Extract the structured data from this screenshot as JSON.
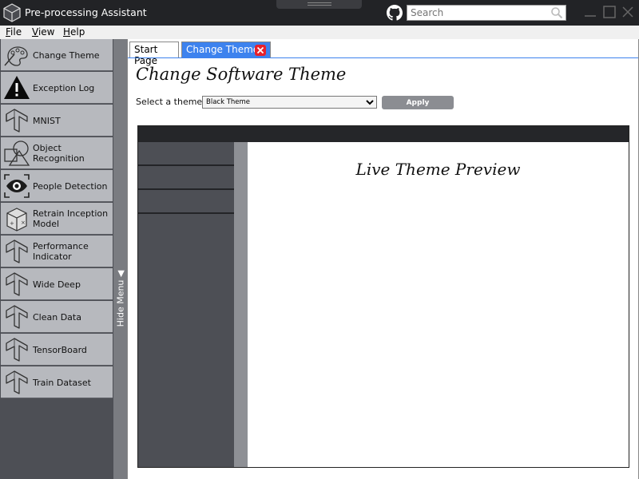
{
  "titlebar": {
    "title": "Pre-processing Assistant",
    "search_placeholder": "Search",
    "icons": [
      "cube-logo-icon",
      "github-icon",
      "search-icon",
      "minimize-icon",
      "maximize-icon",
      "close-icon"
    ]
  },
  "menu": {
    "items": [
      {
        "first": "F",
        "rest": "ile"
      },
      {
        "first": "V",
        "rest": "iew"
      },
      {
        "first": "H",
        "rest": "elp"
      }
    ]
  },
  "sidebar": {
    "items": [
      {
        "label": "Change Theme",
        "icon": "palette-icon"
      },
      {
        "label": "Exception Log",
        "icon": "warning-icon"
      },
      {
        "label": "MNIST",
        "icon": "tensorflow-icon"
      },
      {
        "label": "Object Recognition",
        "icon": "shapes-icon"
      },
      {
        "label": "People Detection",
        "icon": "eye-icon"
      },
      {
        "label": "Retrain Inception Model",
        "icon": "box-icon"
      },
      {
        "label": "Performance Indicator",
        "icon": "tensorflow-icon"
      },
      {
        "label": "Wide Deep",
        "icon": "tensorflow-icon"
      },
      {
        "label": "Clean Data",
        "icon": "tensorflow-icon"
      },
      {
        "label": "TensorBoard",
        "icon": "tensorflow-icon"
      },
      {
        "label": "Train Dataset",
        "icon": "tensorflow-icon"
      }
    ],
    "hide_menu_label": "Hide Menu ◀"
  },
  "tabs": [
    {
      "label": "Start Page",
      "active": false
    },
    {
      "label": "Change Theme",
      "active": true
    }
  ],
  "main": {
    "title": "Change Software Theme",
    "select_label": "Select a theme",
    "selected_theme": "Black Theme",
    "apply_label": "Apply"
  },
  "preview": {
    "title": "Live Theme Preview"
  },
  "colors": {
    "titlebar": "#222326",
    "sidebar": "#4d4f55",
    "nav_item": "#b7b9be",
    "accent_tab": "#3d82ee",
    "tab_close": "#e8212b",
    "apply_button": "#8b8d92"
  }
}
